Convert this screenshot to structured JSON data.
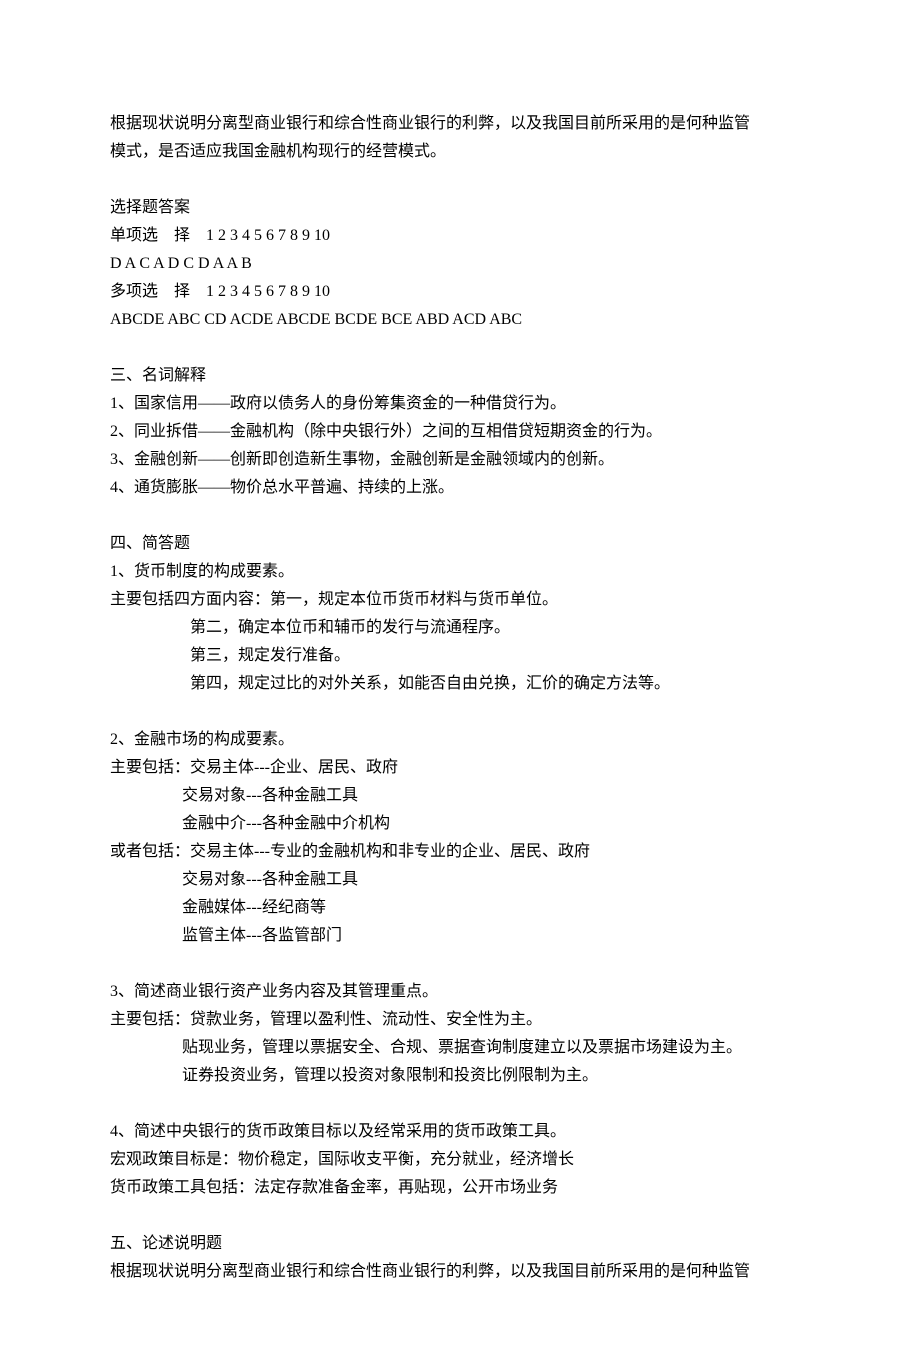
{
  "intro": {
    "line1": "根据现状说明分离型商业银行和综合性商业银行的利弊，以及我国目前所采用的是何种监管",
    "line2": "模式，是否适应我国金融机构现行的经营模式。"
  },
  "choice": {
    "title": "选择题答案",
    "single_label": "单项选　择　1 2 3 4 5 6 7 8 9 10",
    "single_answers": "D A C A D C D A A B",
    "multi_label": "多项选　择　1 2 3 4 5 6 7 8 9 10",
    "multi_answers": "ABCDE ABC CD ACDE ABCDE BCDE BCE ABD ACD ABC"
  },
  "section3": {
    "title": "三、名词解释",
    "items": [
      "1、国家信用——政府以债务人的身份筹集资金的一种借贷行为。",
      "2、同业拆借——金融机构（除中央银行外）之间的互相借贷短期资金的行为。",
      "3、金融创新——创新即创造新生事物，金融创新是金融领域内的创新。",
      "4、通货膨胀——物价总水平普遍、持续的上涨。"
    ]
  },
  "section4": {
    "title": "四、简答题",
    "q1": {
      "question": "1、货币制度的构成要素。",
      "intro": "主要包括四方面内容：第一，规定本位币货币材料与货币单位。",
      "lines": [
        "第二，确定本位币和辅币的发行与流通程序。",
        "第三，规定发行准备。",
        "第四，规定过比的对外关系，如能否自由兑换，汇价的确定方法等。"
      ]
    },
    "q2": {
      "question": "2、金融市场的构成要素。",
      "intro1": "主要包括：交易主体---企业、居民、政府",
      "block1": [
        "交易对象---各种金融工具",
        "金融中介---各种金融中介机构"
      ],
      "intro2": "或者包括：交易主体---专业的金融机构和非专业的企业、居民、政府",
      "block2": [
        "交易对象---各种金融工具",
        "金融媒体---经纪商等",
        "监管主体---各监管部门"
      ]
    },
    "q3": {
      "question": "3、简述商业银行资产业务内容及其管理重点。",
      "intro": "主要包括：贷款业务，管理以盈利性、流动性、安全性为主。",
      "lines": [
        "贴现业务，管理以票据安全、合规、票据查询制度建立以及票据市场建设为主。",
        "证券投资业务，管理以投资对象限制和投资比例限制为主。"
      ]
    },
    "q4": {
      "question": "4、简述中央银行的货币政策目标以及经常采用的货币政策工具。",
      "lines": [
        "宏观政策目标是：物价稳定，国际收支平衡，充分就业，经济增长",
        "货币政策工具包括：法定存款准备金率，再贴现，公开市场业务"
      ]
    }
  },
  "section5": {
    "title": "五、论述说明题",
    "line1": "根据现状说明分离型商业银行和综合性商业银行的利弊，以及我国目前所采用的是何种监管"
  }
}
